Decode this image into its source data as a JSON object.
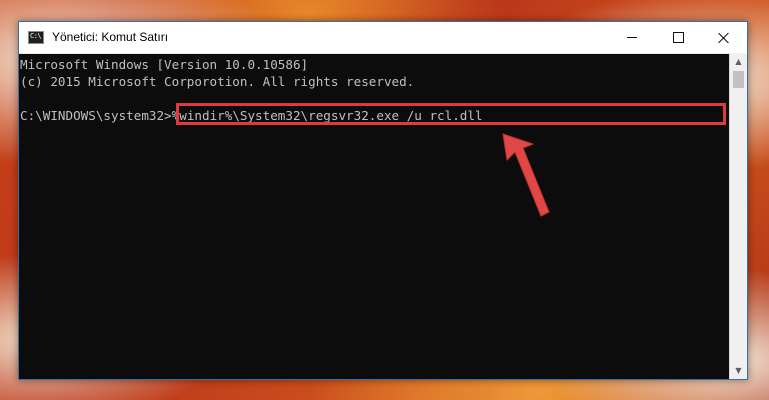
{
  "window": {
    "title": "Yönetici: Komut Satırı",
    "icon_label": "C:\\"
  },
  "console": {
    "lines": [
      "Microsoft Windows [Version 10.0.10586]",
      "(c) 2015 Microsoft Corporotion. All rights reserved."
    ],
    "prompt": "C:\\WINDOWS\\system32>",
    "command": "%windir%\\System32\\regsvr32.exe /u rcl.dll"
  },
  "colors": {
    "console_bg": "#0c0c0c",
    "console_text": "#c0c0c0",
    "highlight": "#e23a3a",
    "arrow": "#e04848"
  },
  "icons": {
    "app": "cmd-icon",
    "minimize": "minimize-icon",
    "maximize": "maximize-icon",
    "close": "close-icon"
  }
}
